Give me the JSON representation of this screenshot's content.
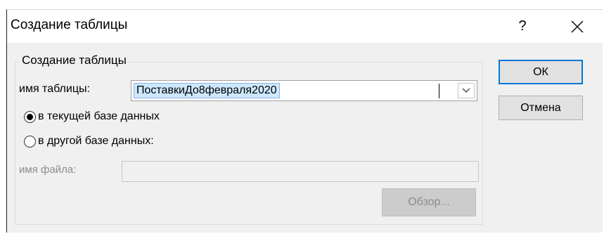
{
  "window": {
    "title": "Создание таблицы",
    "help_glyph": "?",
    "close_icon": "close-icon"
  },
  "group": {
    "legend": "Создание таблицы",
    "table_name_label": "имя таблицы:",
    "table_name_value": "ПоставкиДо8февраля2020",
    "dropdown_icon": "chevron-down-icon",
    "radio_current_db": "в текущей базе данных",
    "radio_current_db_selected": true,
    "radio_other_db": "в другой базе данных:",
    "radio_other_db_selected": false,
    "file_name_label": "имя файла:",
    "file_name_value": "",
    "browse_label": "Обзор..."
  },
  "buttons": {
    "ok": "ОК",
    "cancel": "Отмена"
  },
  "colors": {
    "accent": "#0078d7",
    "selection": "#cde8ff"
  }
}
